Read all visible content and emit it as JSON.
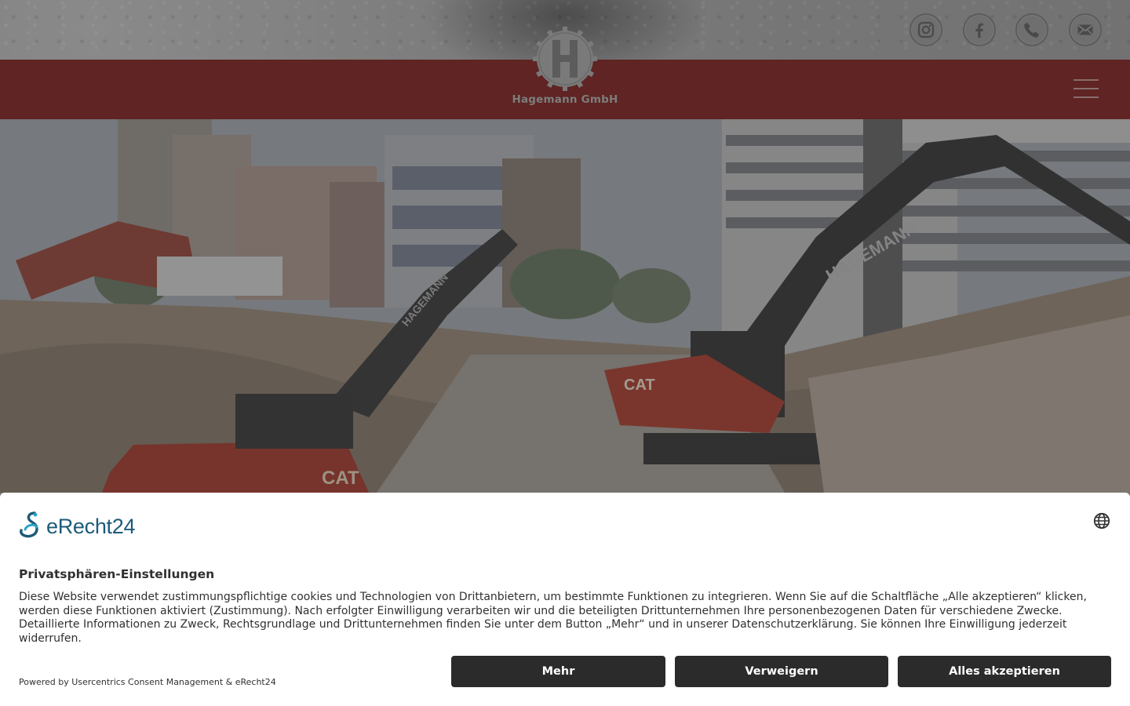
{
  "header": {
    "logo_text": "Hagemann GmbH",
    "social": [
      {
        "icon": "instagram-icon"
      },
      {
        "icon": "facebook-icon"
      },
      {
        "icon": "phone-icon"
      },
      {
        "icon": "mail-icon"
      }
    ],
    "menu_icon": "hamburger-menu-icon"
  },
  "colors": {
    "nav_bar": "#5f2423",
    "consent_button": "#2b2b2b",
    "brand_blue": "#1d5b79"
  },
  "hero": {
    "excavator_lettering": "HAGEMANN",
    "machine_brand_lettering": "CAT"
  },
  "consent": {
    "brand": "eRecht24",
    "title": "Privatsphären-Einstellungen",
    "text": "Diese Website verwendet zustimmungspflichtige cookies und Technologien von Drittanbietern, um bestimmte Funktionen zu integrieren. Wenn Sie auf die Schaltfläche „Alle akzeptieren“ klicken, werden diese Funktionen aktiviert (Zustimmung). Nach erfolgter Einwilligung verarbeiten wir und die beteiligten Drittunternehmen Ihre personenbezogenen Daten für verschiedene Zwecke. Detaillierte Informationen zu Zweck, Rechtsgrundlage und Drittunternehmen finden Sie unter dem Button „Mehr“ und in unserer Datenschutzerklärung. Sie können Ihre Einwilligung jederzeit widerrufen.",
    "powered_by": "Powered by Usercentrics Consent Management & eRecht24",
    "buttons": {
      "more": "Mehr",
      "deny": "Verweigern",
      "accept": "Alles akzeptieren"
    },
    "language_icon": "globe-icon"
  }
}
